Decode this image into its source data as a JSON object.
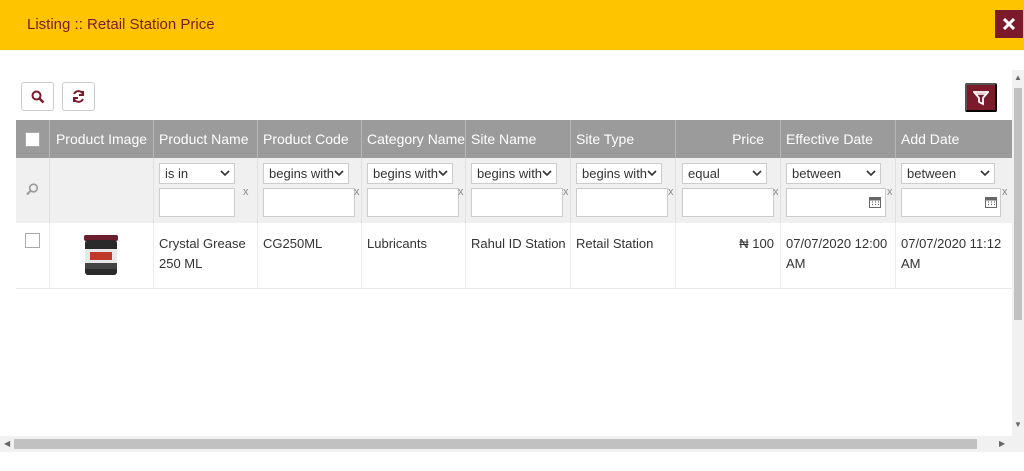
{
  "header": {
    "title": "Listing :: Retail Station Price"
  },
  "colors": {
    "accent": "#7a1a2b",
    "header_bg": "#ffc400",
    "grid_header": "#9b9b9b"
  },
  "toolbar": {
    "search_icon": "search-icon",
    "refresh_icon": "refresh-icon",
    "filter_icon": "filter-icon"
  },
  "columns": [
    {
      "label": "Product Image"
    },
    {
      "label": "Product Name"
    },
    {
      "label": "Product Code"
    },
    {
      "label": "Category Name"
    },
    {
      "label": "Site Name"
    },
    {
      "label": "Site Type"
    },
    {
      "label": "Price"
    },
    {
      "label": "Effective Date"
    },
    {
      "label": "Add Date"
    }
  ],
  "filters": [
    {
      "op": "is in",
      "x": "x"
    },
    {
      "op": "begins with",
      "x": "x"
    },
    {
      "op": "begins with",
      "x": "x"
    },
    {
      "op": "begins with",
      "x": "x"
    },
    {
      "op": "begins with",
      "x": "x"
    },
    {
      "op": "equal",
      "x": "x"
    },
    {
      "op": "between",
      "x": "x"
    },
    {
      "op": "between",
      "x": "x"
    }
  ],
  "rows": [
    {
      "product_name": "Crystal Grease 250 ML",
      "product_code": "CG250ML",
      "category_name": "Lubricants",
      "site_name": "Rahul ID Station",
      "site_type": "Retail Station",
      "price": "₦ 100",
      "effective_date": "07/07/2020 12:00 AM",
      "add_date": "07/07/2020 11:12 AM"
    }
  ]
}
